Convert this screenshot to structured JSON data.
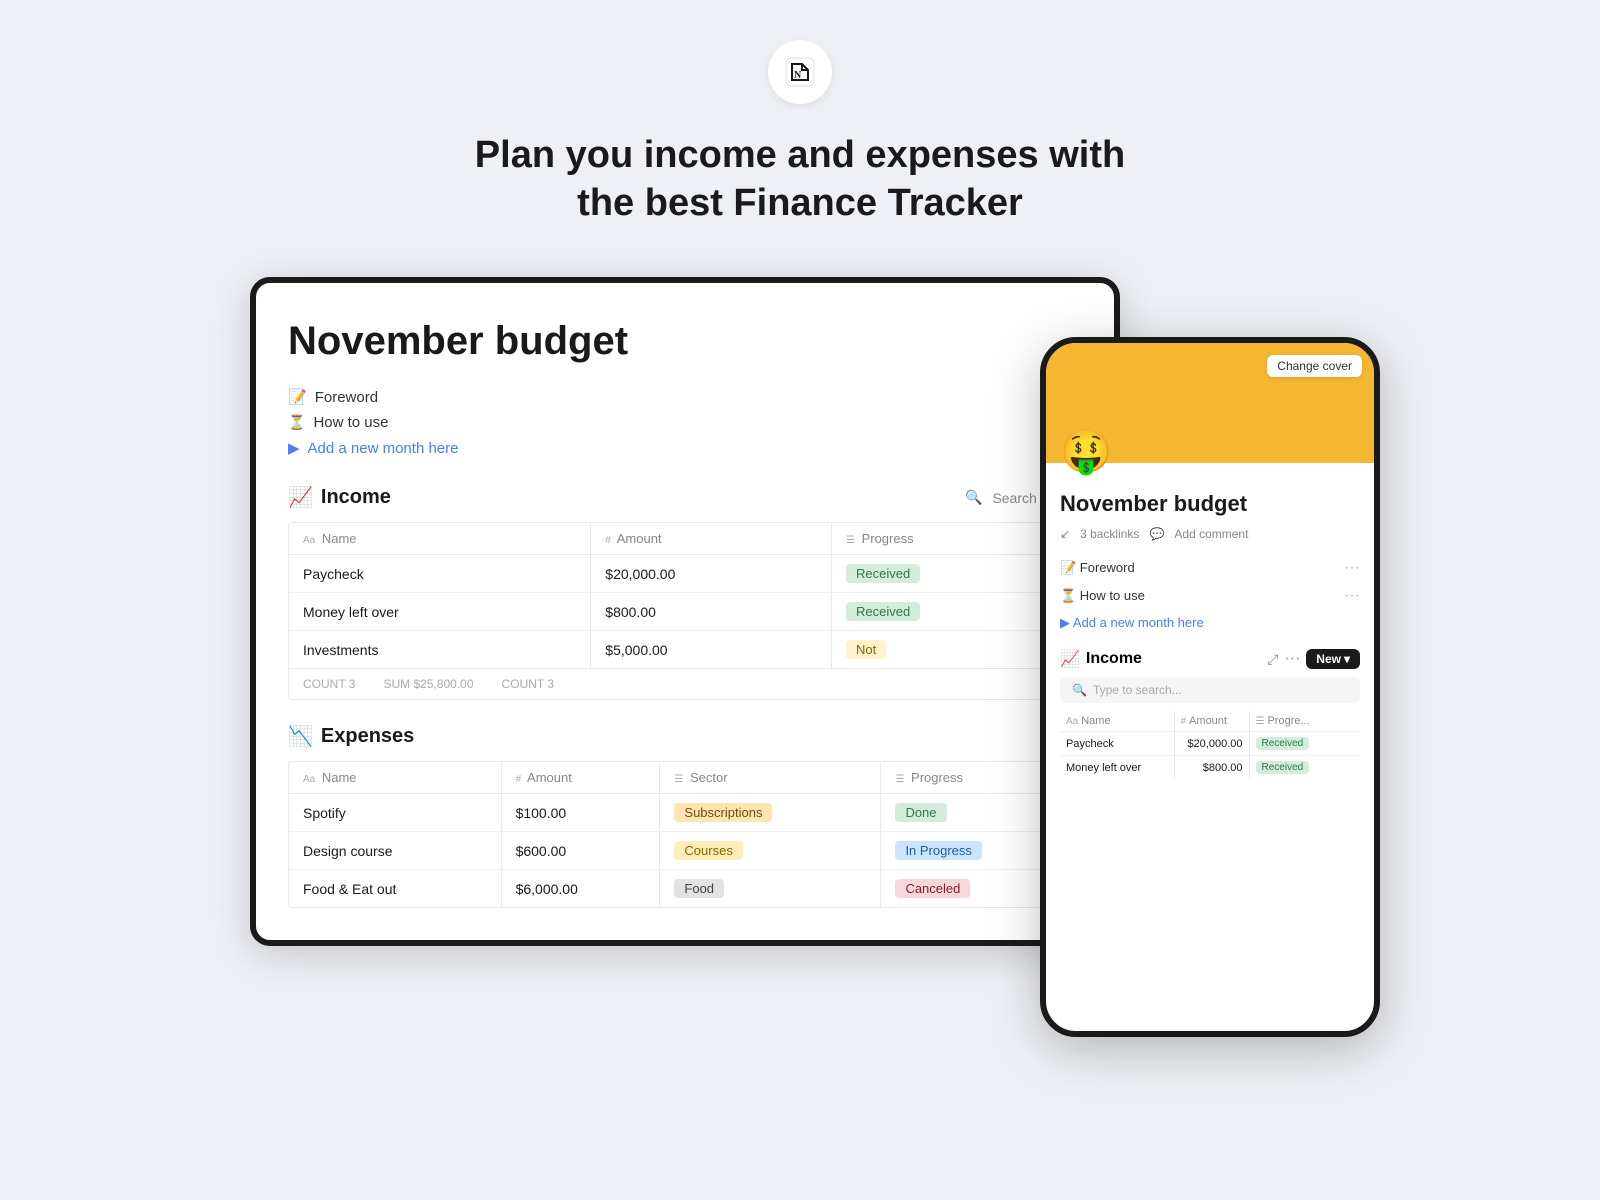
{
  "hero": {
    "title_line1": "Plan you income and expenses with",
    "title_line2": "the best Finance Tracker"
  },
  "tablet": {
    "page_title": "November budget",
    "page_items": [
      {
        "icon": "📝",
        "label": "Foreword",
        "type": "text"
      },
      {
        "icon": "⏳",
        "label": "How to use",
        "type": "text"
      },
      {
        "icon": "▶",
        "label": "Add a new month here",
        "type": "link"
      }
    ],
    "income": {
      "title": "Income",
      "icon": "📈",
      "search_label": "Search",
      "columns": [
        "Name",
        "Amount",
        "Progress"
      ],
      "rows": [
        {
          "name": "Paycheck",
          "amount": "$20,000.00",
          "progress": "Received",
          "progress_type": "received"
        },
        {
          "name": "Money left over",
          "amount": "$800.00",
          "progress": "Received",
          "progress_type": "received"
        },
        {
          "name": "Investments",
          "amount": "$5,000.00",
          "progress": "Not",
          "progress_type": "not"
        }
      ],
      "footer": {
        "count": "3",
        "sum": "$25,800.00",
        "count2": "3"
      }
    },
    "expenses": {
      "title": "Expenses",
      "icon": "📉",
      "columns": [
        "Name",
        "Amount",
        "Sector",
        "Progress"
      ],
      "rows": [
        {
          "name": "Spotify",
          "amount": "$100.00",
          "sector": "Subscriptions",
          "sector_type": "sub",
          "progress": "Done",
          "progress_type": "done"
        },
        {
          "name": "Design course",
          "amount": "$600.00",
          "sector": "Courses",
          "sector_type": "courses",
          "progress": "In Progress",
          "progress_type": "inprogress"
        },
        {
          "name": "Food & Eat out",
          "amount": "$6,000.00",
          "sector": "Food",
          "sector_type": "food",
          "progress": "Canceled",
          "progress_type": "canceled"
        }
      ]
    }
  },
  "mobile": {
    "cover_btn": "Change cover",
    "emoji": "🤑",
    "page_title": "November budget",
    "backlinks": "3 backlinks",
    "add_comment": "Add comment",
    "page_items": [
      {
        "icon": "📝",
        "label": "Foreword",
        "type": "text"
      },
      {
        "icon": "⏳",
        "label": "How to use",
        "type": "text"
      },
      {
        "icon": "▶",
        "label": "Add a new month here",
        "type": "link"
      }
    ],
    "income_title": "Income",
    "income_icon": "📈",
    "new_btn": "New",
    "search_placeholder": "Type to search...",
    "table_columns": [
      "Name",
      "Amount",
      "Progre..."
    ],
    "table_rows": [
      {
        "name": "Paycheck",
        "amount": "$20,000.00",
        "progress": "Received",
        "progress_type": "received"
      },
      {
        "name": "Money left over",
        "amount": "$800.00",
        "progress": "Received",
        "progress_type": "received"
      }
    ]
  },
  "icons": {
    "notion": "N",
    "search": "🔍",
    "expand": "⤢",
    "dots": "···",
    "backlink": "↙",
    "comment": "💬",
    "hash": "#",
    "text": "Aa",
    "list": "☰"
  }
}
